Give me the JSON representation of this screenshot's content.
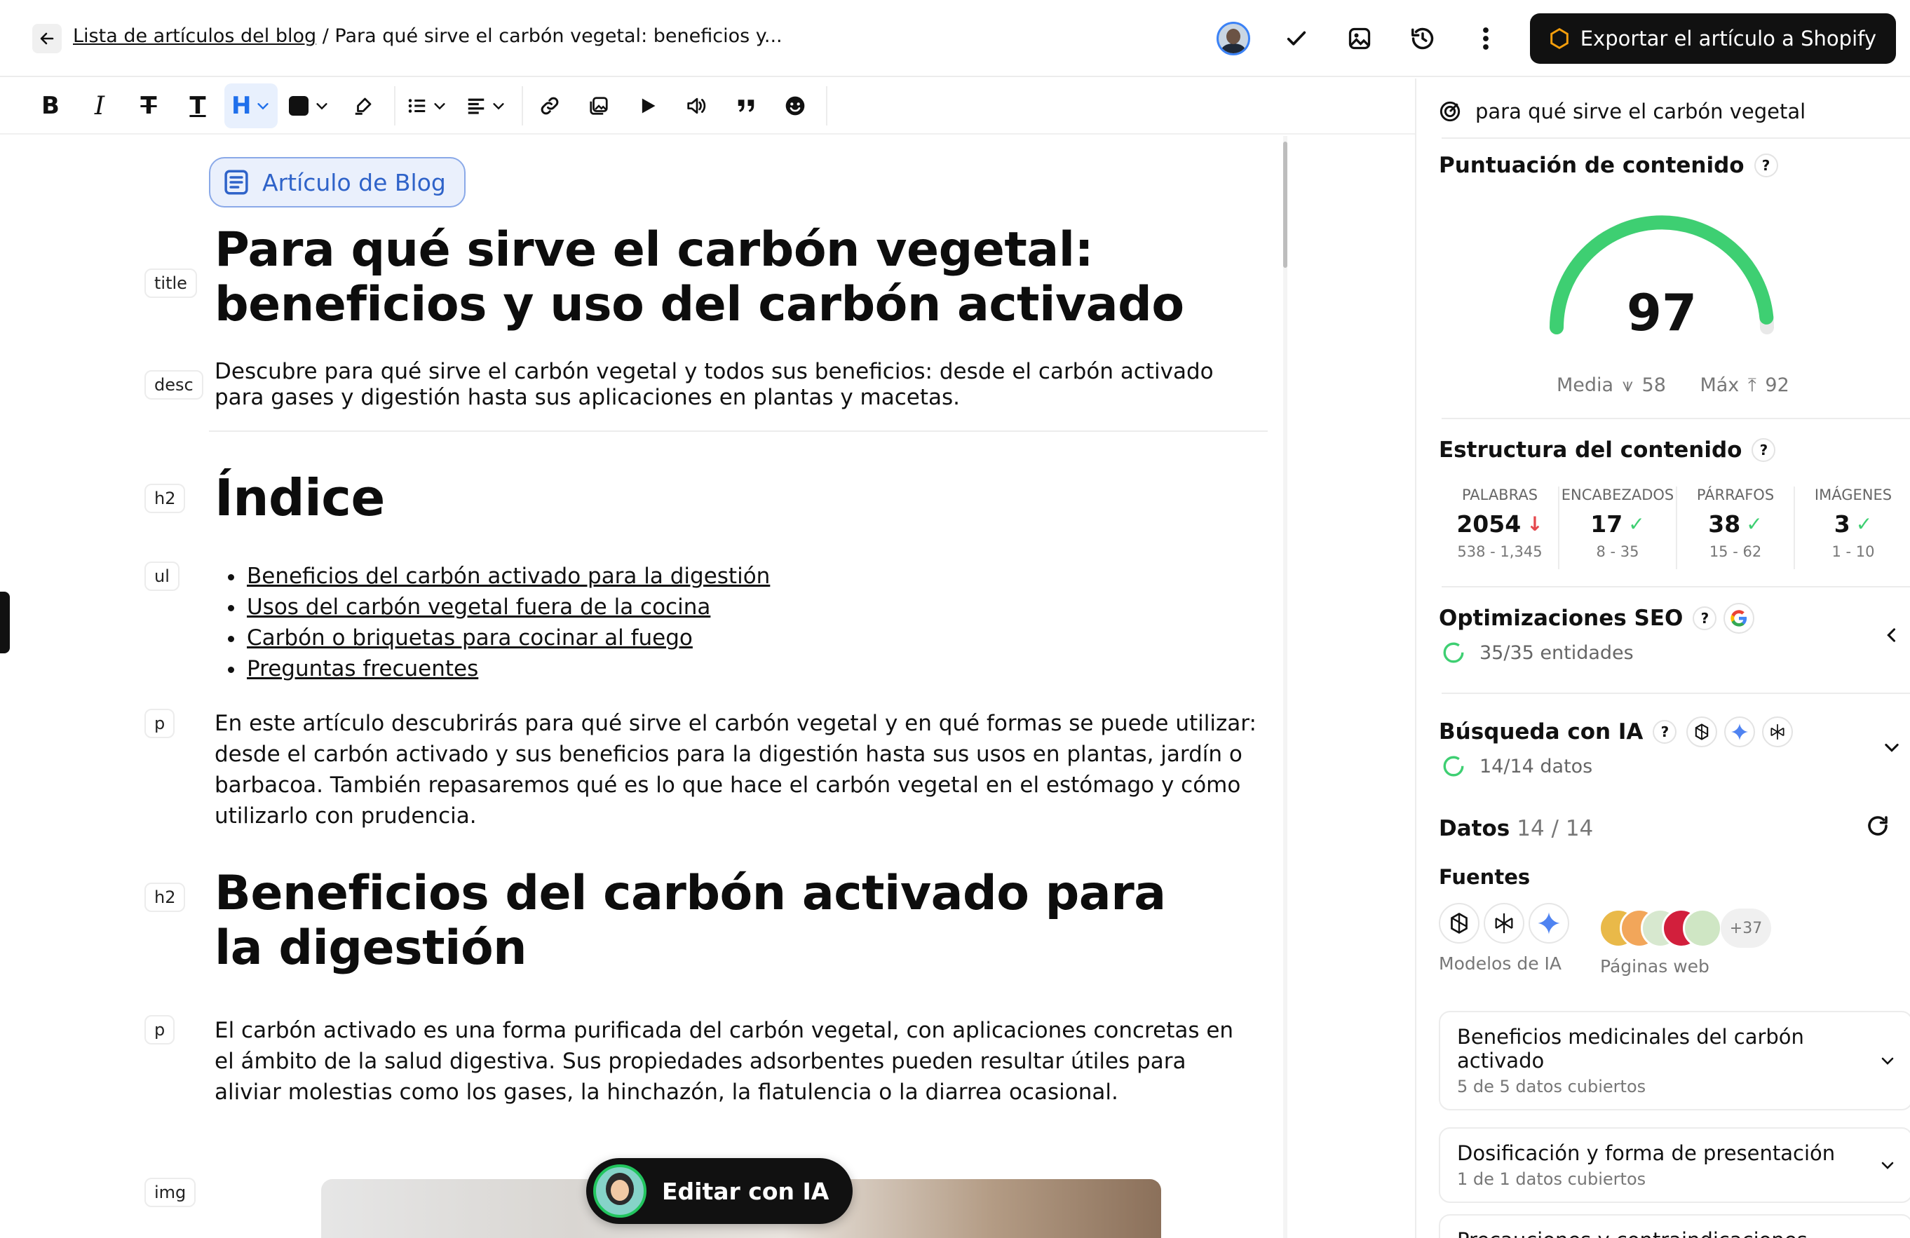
{
  "topbar": {
    "breadcrumb_link": "Lista de artículos del blog",
    "breadcrumb_sep": " / ",
    "breadcrumb_current": "Para qué sirve el carbón vegetal: beneficios y...",
    "export_label": "Exportar el artículo a Shopify"
  },
  "toolbar": {
    "items": [
      "bold-icon",
      "italic-icon",
      "strikethrough-icon",
      "text-format-icon",
      "heading-icon",
      "color-icon",
      "highlighter-icon",
      "list-icon",
      "align-icon",
      "link-icon",
      "gallery-icon",
      "video-icon",
      "embed-icon",
      "quote-icon",
      "emoji-icon"
    ]
  },
  "editor": {
    "type_pill": "Artículo de Blog",
    "tags": {
      "title": "title",
      "desc": "desc",
      "h2": "h2",
      "ul": "ul",
      "p": "p",
      "img": "img"
    },
    "title": "Para qué sirve el carbón vegetal: beneficios y uso del carbón activado",
    "description": "Descubre para qué sirve el carbón vegetal y todos sus beneficios: desde el carbón activado para gases y digestión hasta sus aplicaciones en plantas y macetas.",
    "h2_index": "Índice",
    "toc": [
      "Beneficios del carbón activado para la digestión",
      "Usos del carbón vegetal fuera de la cocina",
      "Carbón o briquetas para cocinar al fuego",
      "Preguntas frecuentes"
    ],
    "intro": "En este artículo descubrirás para qué sirve el carbón vegetal y en qué formas se puede utilizar: desde el carbón activado y sus beneficios para la digestión hasta sus usos en plantas, jardín o barbacoa. También repasaremos qué es lo que hace el carbón vegetal en el estómago y cómo utilizarlo con prudencia.",
    "h2_benefits": "Beneficios del carbón activado para la digestión",
    "benefits_p": "El carbón activado es una forma purificada del carbón vegetal, con aplicaciones concretas en el ámbito de la salud digestiva. Sus propiedades adsorbentes pueden resultar útiles para aliviar molestias como los gases, la hinchazón, la flatulencia o la diarrea ocasional.",
    "ai_button": "Editar con IA"
  },
  "panel": {
    "keyword": "para qué sirve el carbón vegetal",
    "score_title": "Puntuación de contenido",
    "score": "97",
    "score_value": 97,
    "average_label": "Media",
    "average": "58",
    "max_label": "Máx",
    "max": "92",
    "structure_title": "Estructura del contenido",
    "stats": [
      {
        "label": "PALABRAS",
        "value": "2054",
        "status": "down",
        "range": "538 - 1,345"
      },
      {
        "label": "ENCABEZADOS",
        "value": "17",
        "status": "ok",
        "range": "8 - 35"
      },
      {
        "label": "PÁRRAFOS",
        "value": "38",
        "status": "ok",
        "range": "15 - 62"
      },
      {
        "label": "IMÁGENES",
        "value": "3",
        "status": "ok",
        "range": "1 - 10"
      }
    ],
    "seo_title": "Optimizaciones SEO",
    "seo_sub": "35/35 entidades",
    "ai_search_title": "Búsqueda con IA",
    "ai_search_sub": "14/14 datos",
    "datos_label": "Datos",
    "datos_count": "14 / 14",
    "fuentes_label": "Fuentes",
    "models_label": "Modelos de IA",
    "web_label": "Páginas web",
    "web_more": "+37",
    "cards": [
      {
        "title": "Beneficios medicinales del carbón activado",
        "sub": "5 de 5 datos cubiertos"
      },
      {
        "title": "Dosificación y forma de presentación",
        "sub": "1 de 1 datos cubiertos"
      },
      {
        "title": "Precauciones y contraindicaciones",
        "sub": ""
      }
    ],
    "colors": {
      "accent_green": "#3ecf72",
      "pill_blue": "#2f63c9"
    }
  }
}
